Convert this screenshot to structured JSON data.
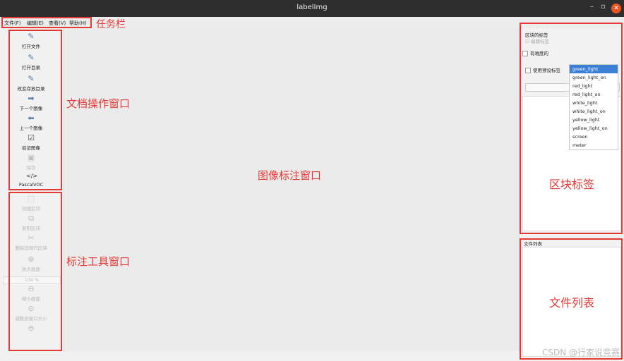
{
  "window": {
    "title": "labelImg",
    "controls": [
      "–",
      "▫",
      "✕"
    ]
  },
  "menu": [
    "文件(F)",
    "编辑(E)",
    "查看(V)",
    "帮助(H)"
  ],
  "toolbar": {
    "file_ops": [
      {
        "label": "打开文件",
        "icon": "open-file-icon"
      },
      {
        "label": "打开目录",
        "icon": "open-dir-icon"
      },
      {
        "label": "改变存放目录",
        "icon": "change-save-dir-icon"
      },
      {
        "label": "下一个图像",
        "icon": "next-image-icon"
      },
      {
        "label": "上一个图像",
        "icon": "prev-image-icon"
      },
      {
        "label": "验证图像",
        "icon": "verify-image-icon"
      },
      {
        "label": "保存",
        "icon": "save-icon"
      },
      {
        "label": "PascalVOC",
        "icon": "format-icon"
      }
    ],
    "tools": [
      {
        "label": "创建区块",
        "icon": "create-box-icon"
      },
      {
        "label": "复制区块",
        "icon": "duplicate-box-icon"
      },
      {
        "label": "删除选择的区块",
        "icon": "delete-box-icon"
      },
      {
        "label": "放大画面",
        "icon": "zoom-in-icon"
      },
      {
        "label": "100 %",
        "icon": ""
      },
      {
        "label": "缩小画面",
        "icon": "zoom-out-icon"
      },
      {
        "label": "调整到窗口大小",
        "icon": "fit-window-icon"
      },
      {
        "label": "",
        "icon": "fit-width-icon"
      }
    ]
  },
  "labels_dock": {
    "title": "区块的标签",
    "edit_label": "编辑标签",
    "difficult": "有难度的",
    "use_default": "使用预设标签",
    "options": [
      "green_light",
      "green_light_on",
      "red_light",
      "red_light_on",
      "white_light",
      "white_light_on",
      "yellow_light",
      "yellow_light_on",
      "screen",
      "meter"
    ],
    "selected": "green_light"
  },
  "file_dock": {
    "title": "文件列表"
  },
  "annotations": {
    "taskbar": "任务栏",
    "doc_ops": "文档操作窗口",
    "image_window": "图像标注窗口",
    "tools_window": "标注工具窗口",
    "labels": "区块标签",
    "file_list": "文件列表"
  },
  "watermark": "CSDN @行家说竞赛",
  "colors": {
    "annotation": "#e53935",
    "selection": "#3c81d7",
    "titlebar": "#2e2e2e"
  }
}
